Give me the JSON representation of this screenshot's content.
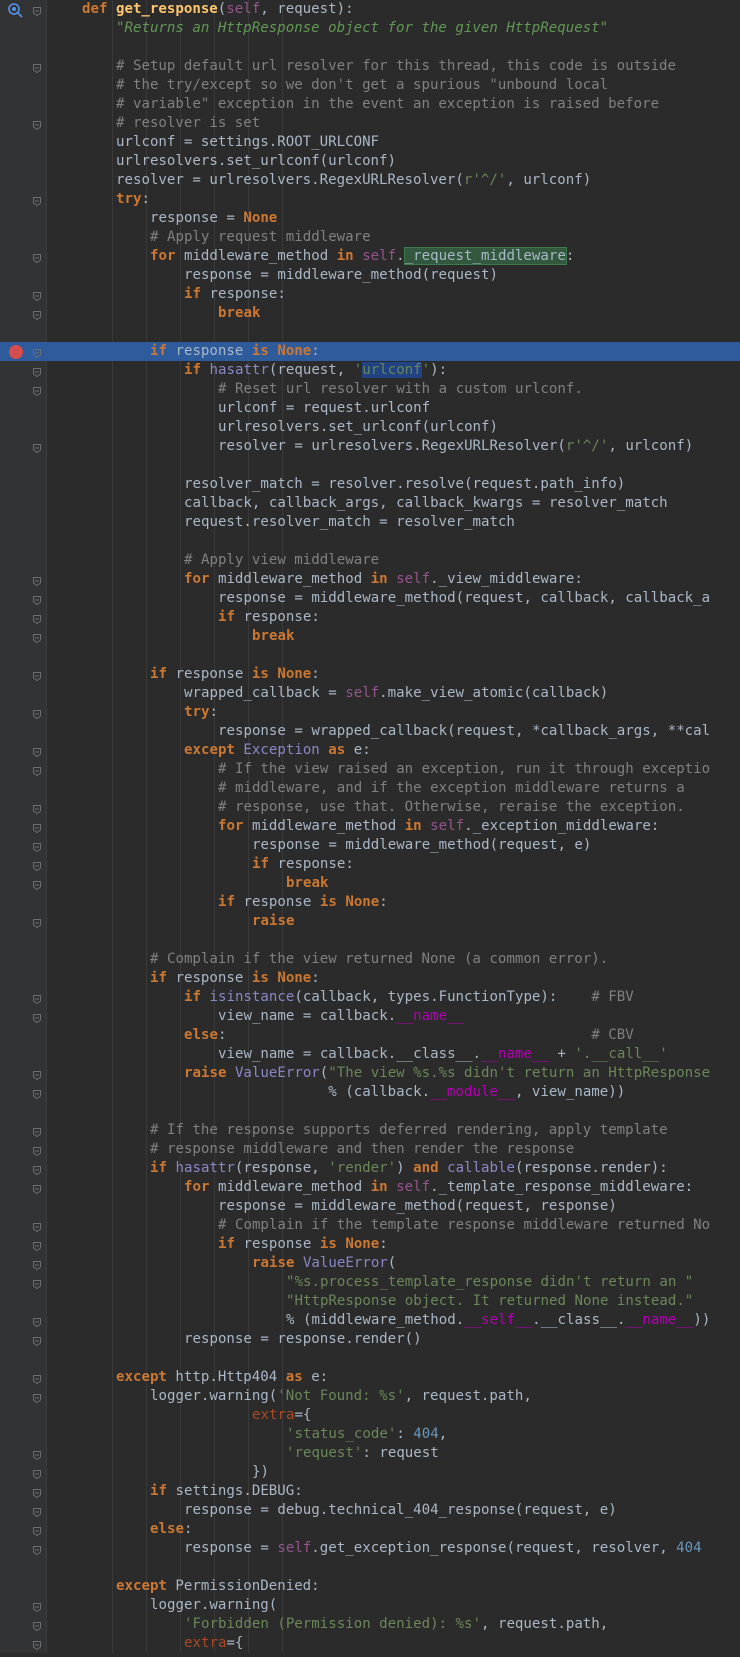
{
  "editor": {
    "language": "python",
    "colors": {
      "background": "#2b2b2b",
      "gutter": "#313335",
      "current_line": "#2d5b9b",
      "breakpoint": "#d44c4c",
      "keyword": "#cc7832",
      "string": "#6a8759",
      "comment": "#808080",
      "number": "#6897bb"
    },
    "highlighted_line": 18,
    "breakpoint_line": 18,
    "debug_marker_line": 0,
    "lines": [
      {
        "indent": 0,
        "text": "def get_response(self, request):"
      },
      {
        "indent": 1,
        "text": "\"Returns an HttpResponse object for the given HttpRequest\""
      },
      {
        "indent": 1,
        "text": ""
      },
      {
        "indent": 1,
        "text": "# Setup default url resolver for this thread, this code is outside"
      },
      {
        "indent": 1,
        "text": "# the try/except so we don't get a spurious \"unbound local"
      },
      {
        "indent": 1,
        "text": "# variable\" exception in the event an exception is raised before"
      },
      {
        "indent": 1,
        "text": "# resolver is set"
      },
      {
        "indent": 1,
        "text": "urlconf = settings.ROOT_URLCONF"
      },
      {
        "indent": 1,
        "text": "urlresolvers.set_urlconf(urlconf)"
      },
      {
        "indent": 1,
        "text": "resolver = urlresolvers.RegexURLResolver(r'^/', urlconf)"
      },
      {
        "indent": 1,
        "text": "try:"
      },
      {
        "indent": 2,
        "text": "response = None"
      },
      {
        "indent": 2,
        "text": "# Apply request middleware"
      },
      {
        "indent": 2,
        "text": "for middleware_method in self._request_middleware:"
      },
      {
        "indent": 3,
        "text": "response = middleware_method(request)"
      },
      {
        "indent": 3,
        "text": "if response:"
      },
      {
        "indent": 4,
        "text": "break"
      },
      {
        "indent": 2,
        "text": ""
      },
      {
        "indent": 2,
        "text": "if response is None:"
      },
      {
        "indent": 3,
        "text": "if hasattr(request, 'urlconf'):"
      },
      {
        "indent": 4,
        "text": "# Reset url resolver with a custom urlconf."
      },
      {
        "indent": 4,
        "text": "urlconf = request.urlconf"
      },
      {
        "indent": 4,
        "text": "urlresolvers.set_urlconf(urlconf)"
      },
      {
        "indent": 4,
        "text": "resolver = urlresolvers.RegexURLResolver(r'^/', urlconf)"
      },
      {
        "indent": 3,
        "text": ""
      },
      {
        "indent": 3,
        "text": "resolver_match = resolver.resolve(request.path_info)"
      },
      {
        "indent": 3,
        "text": "callback, callback_args, callback_kwargs = resolver_match"
      },
      {
        "indent": 3,
        "text": "request.resolver_match = resolver_match"
      },
      {
        "indent": 3,
        "text": ""
      },
      {
        "indent": 3,
        "text": "# Apply view middleware"
      },
      {
        "indent": 3,
        "text": "for middleware_method in self._view_middleware:"
      },
      {
        "indent": 4,
        "text": "response = middleware_method(request, callback, callback_a"
      },
      {
        "indent": 4,
        "text": "if response:"
      },
      {
        "indent": 5,
        "text": "break"
      },
      {
        "indent": 2,
        "text": ""
      },
      {
        "indent": 2,
        "text": "if response is None:"
      },
      {
        "indent": 3,
        "text": "wrapped_callback = self.make_view_atomic(callback)"
      },
      {
        "indent": 3,
        "text": "try:"
      },
      {
        "indent": 4,
        "text": "response = wrapped_callback(request, *callback_args, **cal"
      },
      {
        "indent": 3,
        "text": "except Exception as e:"
      },
      {
        "indent": 4,
        "text": "# If the view raised an exception, run it through exceptio"
      },
      {
        "indent": 4,
        "text": "# middleware, and if the exception middleware returns a"
      },
      {
        "indent": 4,
        "text": "# response, use that. Otherwise, reraise the exception."
      },
      {
        "indent": 4,
        "text": "for middleware_method in self._exception_middleware:"
      },
      {
        "indent": 5,
        "text": "response = middleware_method(request, e)"
      },
      {
        "indent": 5,
        "text": "if response:"
      },
      {
        "indent": 6,
        "text": "break"
      },
      {
        "indent": 4,
        "text": "if response is None:"
      },
      {
        "indent": 5,
        "text": "raise"
      },
      {
        "indent": 2,
        "text": ""
      },
      {
        "indent": 2,
        "text": "# Complain if the view returned None (a common error)."
      },
      {
        "indent": 2,
        "text": "if response is None:"
      },
      {
        "indent": 3,
        "text": "if isinstance(callback, types.FunctionType):    # FBV"
      },
      {
        "indent": 4,
        "text": "view_name = callback.__name__"
      },
      {
        "indent": 3,
        "text": "else:                                           # CBV"
      },
      {
        "indent": 4,
        "text": "view_name = callback.__class__.__name__ + '.__call__'"
      },
      {
        "indent": 3,
        "text": "raise ValueError(\"The view %s.%s didn't return an HttpResponse"
      },
      {
        "indent": 3,
        "text": "                 % (callback.__module__, view_name))"
      },
      {
        "indent": 2,
        "text": ""
      },
      {
        "indent": 2,
        "text": "# If the response supports deferred rendering, apply template"
      },
      {
        "indent": 2,
        "text": "# response middleware and then render the response"
      },
      {
        "indent": 2,
        "text": "if hasattr(response, 'render') and callable(response.render):"
      },
      {
        "indent": 3,
        "text": "for middleware_method in self._template_response_middleware:"
      },
      {
        "indent": 4,
        "text": "response = middleware_method(request, response)"
      },
      {
        "indent": 4,
        "text": "# Complain if the template response middleware returned No"
      },
      {
        "indent": 4,
        "text": "if response is None:"
      },
      {
        "indent": 5,
        "text": "raise ValueError("
      },
      {
        "indent": 6,
        "text": "\"%s.process_template_response didn't return an \""
      },
      {
        "indent": 6,
        "text": "\"HttpResponse object. It returned None instead.\""
      },
      {
        "indent": 6,
        "text": "% (middleware_method.__self__.__class__.__name__))"
      },
      {
        "indent": 3,
        "text": "response = response.render()"
      },
      {
        "indent": 1,
        "text": ""
      },
      {
        "indent": 1,
        "text": "except http.Http404 as e:"
      },
      {
        "indent": 2,
        "text": "logger.warning('Not Found: %s', request.path,"
      },
      {
        "indent": 5,
        "text": "extra={"
      },
      {
        "indent": 6,
        "text": "'status_code': 404,"
      },
      {
        "indent": 6,
        "text": "'request': request"
      },
      {
        "indent": 5,
        "text": "})"
      },
      {
        "indent": 2,
        "text": "if settings.DEBUG:"
      },
      {
        "indent": 3,
        "text": "response = debug.technical_404_response(request, e)"
      },
      {
        "indent": 2,
        "text": "else:"
      },
      {
        "indent": 3,
        "text": "response = self.get_exception_response(request, resolver, 404"
      },
      {
        "indent": 1,
        "text": ""
      },
      {
        "indent": 1,
        "text": "except PermissionDenied:"
      },
      {
        "indent": 2,
        "text": "logger.warning("
      },
      {
        "indent": 3,
        "text": "'Forbidden (Permission denied): %s', request.path,"
      },
      {
        "indent": 3,
        "text": "extra={"
      }
    ]
  }
}
